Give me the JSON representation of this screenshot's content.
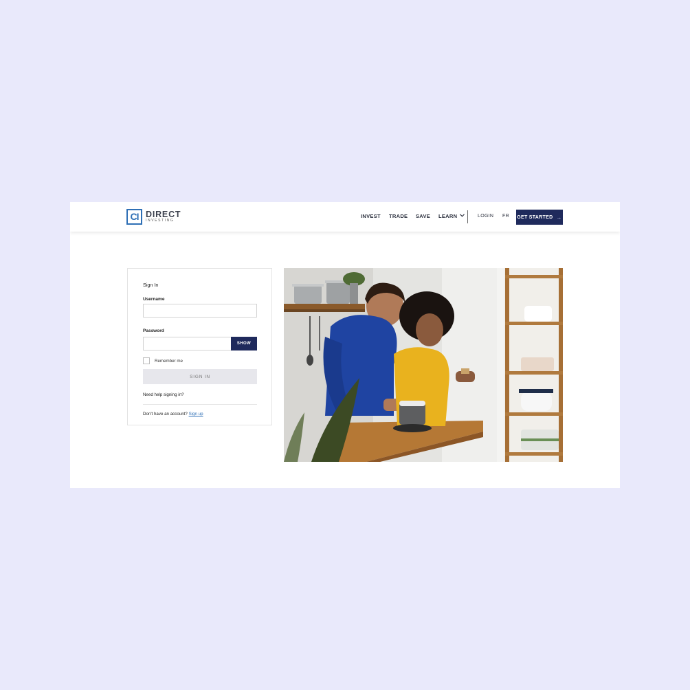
{
  "header": {
    "logo": {
      "mark": "CI",
      "name": "DIRECT",
      "tagline": "INVESTING"
    },
    "nav": [
      {
        "label": "INVEST"
      },
      {
        "label": "TRADE"
      },
      {
        "label": "SAVE"
      },
      {
        "label": "LEARN",
        "icon": "chevron-down-icon"
      }
    ],
    "login": "LOGIN",
    "language": "FR",
    "cta": {
      "label": "GET STARTED",
      "icon": "arrow-right-icon"
    }
  },
  "signin": {
    "title": "Sign In",
    "username_label": "Username",
    "username_value": "",
    "password_label": "Password",
    "password_value": "",
    "show_label": "SHOW",
    "remember_label": "Remember me",
    "remember_checked": false,
    "submit_label": "SIGN IN",
    "help_link": "Need help signing in?",
    "no_account_text": "Don't have an account?",
    "signup_link": "Sign up"
  },
  "colors": {
    "page_background": "#e9e9fb",
    "brand_navy": "#1f2a5c",
    "brand_blue": "#2e6fb5",
    "button_disabled": "#e7e7ec"
  }
}
